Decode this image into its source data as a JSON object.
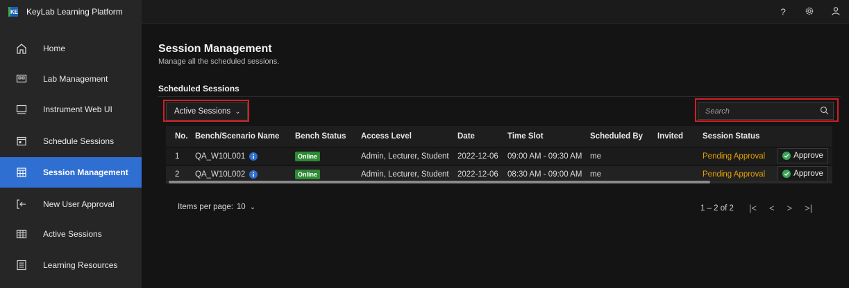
{
  "app": {
    "title": "KeyLab Learning Platform",
    "logo_text": "KE"
  },
  "topbar": {
    "help_icon": "help-icon",
    "settings_icon": "gear-icon",
    "user_icon": "user-icon"
  },
  "sidebar": {
    "items": [
      {
        "label": "Home",
        "icon": "home-icon",
        "active": false
      },
      {
        "label": "Lab Management",
        "icon": "lab-icon",
        "active": false
      },
      {
        "label": "Instrument Web UI",
        "icon": "monitor-icon",
        "active": false
      },
      {
        "label": "Schedule Sessions",
        "icon": "calendar-icon",
        "active": false
      },
      {
        "label": "Session Management",
        "icon": "calendar-grid-icon",
        "active": true
      },
      {
        "label": "New User Approval",
        "icon": "user-login-icon",
        "active": false
      },
      {
        "label": "Active Sessions",
        "icon": "table-icon",
        "active": false
      },
      {
        "label": "Learning Resources",
        "icon": "book-icon",
        "active": false
      }
    ]
  },
  "main": {
    "title": "Session Management",
    "subtitle": "Manage all the scheduled sessions.",
    "section_title": "Scheduled Sessions",
    "filter_label": "Active Sessions",
    "search_placeholder": "Search"
  },
  "table": {
    "headers": [
      "No.",
      "Bench/Scenario Name",
      "Bench Status",
      "Access Level",
      "Date",
      "Time Slot",
      "Scheduled By",
      "Invited",
      "Session Status"
    ],
    "rows": [
      {
        "no": "1",
        "name": "QA_W10L001",
        "status": "Online",
        "access": "Admin, Lecturer, Student",
        "date": "2022-12-06",
        "slot": "09:00 AM - 09:30 AM",
        "by": "me",
        "invited": "",
        "session_status": "Pending Approval",
        "action": "Approve"
      },
      {
        "no": "2",
        "name": "QA_W10L002",
        "status": "Online",
        "access": "Admin, Lecturer, Student",
        "date": "2022-12-06",
        "slot": "08:30 AM - 09:00 AM",
        "by": "me",
        "invited": "",
        "session_status": "Pending Approval",
        "action": "Approve"
      }
    ]
  },
  "pagination": {
    "items_per_page_label": "Items per page:",
    "items_per_page": "10",
    "range": "1 – 2 of 2"
  },
  "colors": {
    "accent": "#2f6fd1",
    "online": "#2e8b34",
    "pending": "#e4a000",
    "highlight": "#d31f26"
  }
}
